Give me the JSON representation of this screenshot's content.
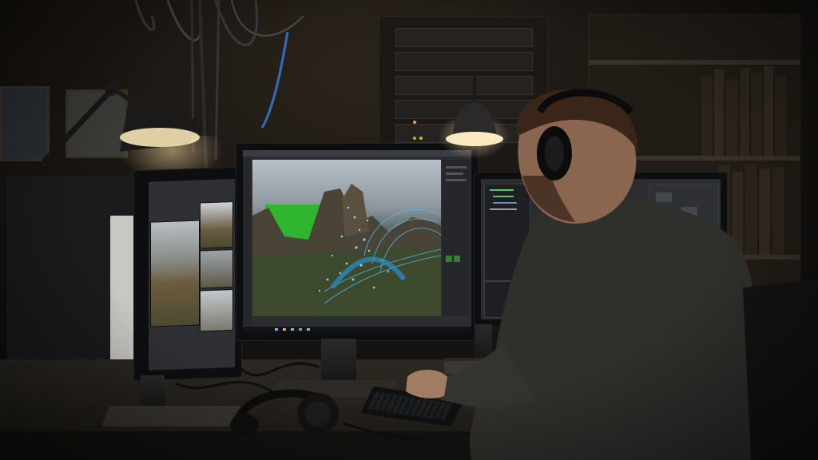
{
  "scene": {
    "colors": {
      "wall": "#1a1612",
      "desk": "#2a2620",
      "lamp_glow": "#f3d9a1",
      "green_screen": "#2fb52f",
      "particles": "#4fc3f7",
      "ui_dark": "#2b2d31"
    },
    "objects": [
      "desk-lamp-left",
      "desk-lamp-center",
      "monitor-portrait-left",
      "monitor-main-center",
      "monitor-right",
      "headphones-on-desk",
      "keyboard",
      "person-with-headset",
      "server-rack",
      "bookshelf",
      "hanging-cables"
    ]
  }
}
